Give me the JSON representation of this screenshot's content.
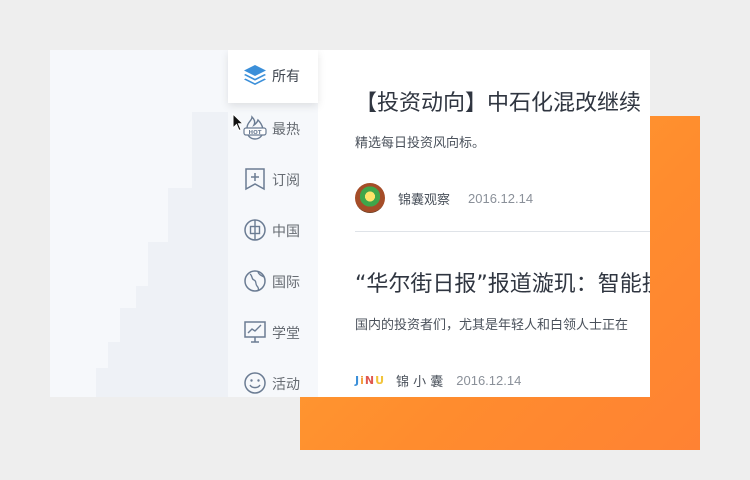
{
  "nav": {
    "items": [
      {
        "label": "所有",
        "icon": "layers-icon",
        "active": true
      },
      {
        "label": "最热",
        "icon": "hot-flame-icon",
        "active": false
      },
      {
        "label": "订阅",
        "icon": "bookmark-plus-icon",
        "active": false
      },
      {
        "label": "中国",
        "icon": "china-coin-icon",
        "active": false
      },
      {
        "label": "国际",
        "icon": "globe-icon",
        "active": false
      },
      {
        "label": "学堂",
        "icon": "chart-board-icon",
        "active": false
      },
      {
        "label": "活动",
        "icon": "smile-icon",
        "active": false
      }
    ],
    "accent": "#3b8fd9"
  },
  "articles": [
    {
      "title": "【投资动向】中石化混改继续",
      "desc": "精选每日投资风向标。",
      "author": "锦囊观察",
      "date": "2016.12.14",
      "avatar": "avatar-photo"
    },
    {
      "title": "“华尔街日报”报道漩玑：智能投",
      "desc": "国内的投资者们，尤其是年轻人和白领人士正在",
      "author": "锦 小 囊",
      "date": "2016.12.14",
      "avatar_text": "JiNU"
    }
  ],
  "colors": {
    "orange": "#ff9430",
    "background": "#eeeeee"
  }
}
